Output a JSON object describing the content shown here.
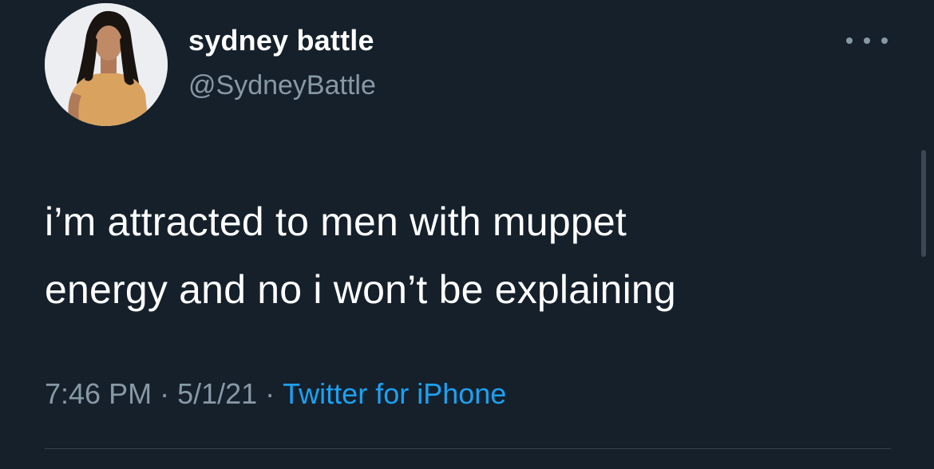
{
  "user": {
    "display_name": "sydney battle",
    "handle": "@SydneyBattle"
  },
  "tweet": {
    "text_lines": [
      "i’m attracted to men with muppet",
      "energy and no i won’t be explaining"
    ],
    "time": "7:46 PM",
    "date": "5/1/21",
    "separator": "·",
    "source": "Twitter for iPhone"
  },
  "icons": {
    "more": "more-options-icon",
    "avatar": "profile-photo"
  },
  "colors": {
    "background": "#15202b",
    "primary_text": "#ffffff",
    "secondary_text": "#8899a6",
    "link": "#1da1f2"
  }
}
